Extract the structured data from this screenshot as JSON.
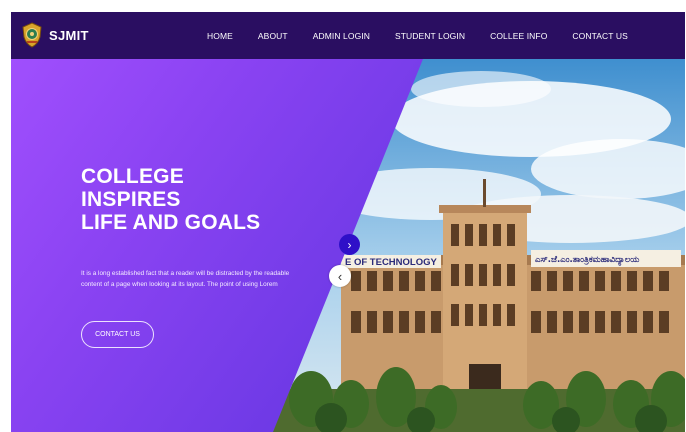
{
  "brand": {
    "name": "SJMIT",
    "logo": "college-emblem-icon"
  },
  "nav": {
    "items": [
      {
        "label": "HOME"
      },
      {
        "label": "ABOUT"
      },
      {
        "label": "ADMIN LOGIN"
      },
      {
        "label": "STUDENT LOGIN"
      },
      {
        "label": "COLLEE INFO"
      },
      {
        "label": "CONTACT US"
      }
    ]
  },
  "hero": {
    "headline": [
      "COLLEGE",
      "INSPIRES",
      "LIFE AND GOALS"
    ],
    "text": "It is a long established fact that a reader will be distracted by the readable content of a page when looking at its layout. The point of using Lorem",
    "cta_label": "CONTACT US",
    "next_icon": "›",
    "prev_icon": "‹",
    "building_sign_left": "E OF TECHNOLOGY",
    "building_sign_right": "ಎಸ್.ಜೆ.ಎಂ.ತಾಂತ್ರಿಕಮಹಾವಿದ್ಯಾಲಯ"
  },
  "colors": {
    "navbar": "#2a0e61",
    "panel_start": "#a04ffd",
    "panel_end": "#5a36e0",
    "next_arrow": "#2f10c8"
  }
}
